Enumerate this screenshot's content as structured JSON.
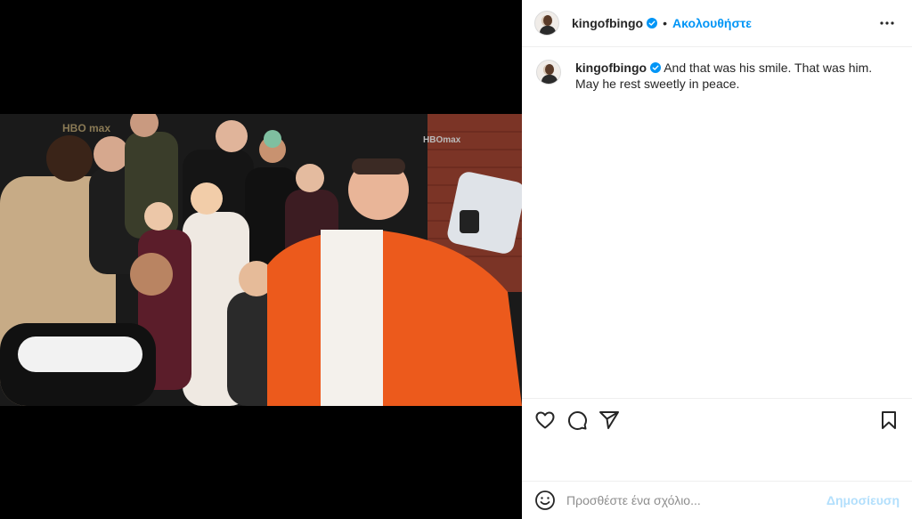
{
  "post": {
    "username": "kingofbingo",
    "follow_label": "Ακολουθήστε",
    "separator": "•",
    "caption": "And that was his smile. That was him. May he rest sweetly in peace."
  },
  "comment": {
    "placeholder": "Προσθέστε ένα σχόλιο...",
    "post_label": "Δημοσίευση"
  },
  "colors": {
    "accent": "#0095f6",
    "post_disabled": "#b2dffc",
    "text": "#262626"
  },
  "icons": {
    "verified": "verified-badge-icon",
    "more": "more-options-icon",
    "like": "heart-icon",
    "comment": "comment-icon",
    "share": "share-icon",
    "save": "bookmark-icon",
    "emoji": "emoji-icon"
  }
}
